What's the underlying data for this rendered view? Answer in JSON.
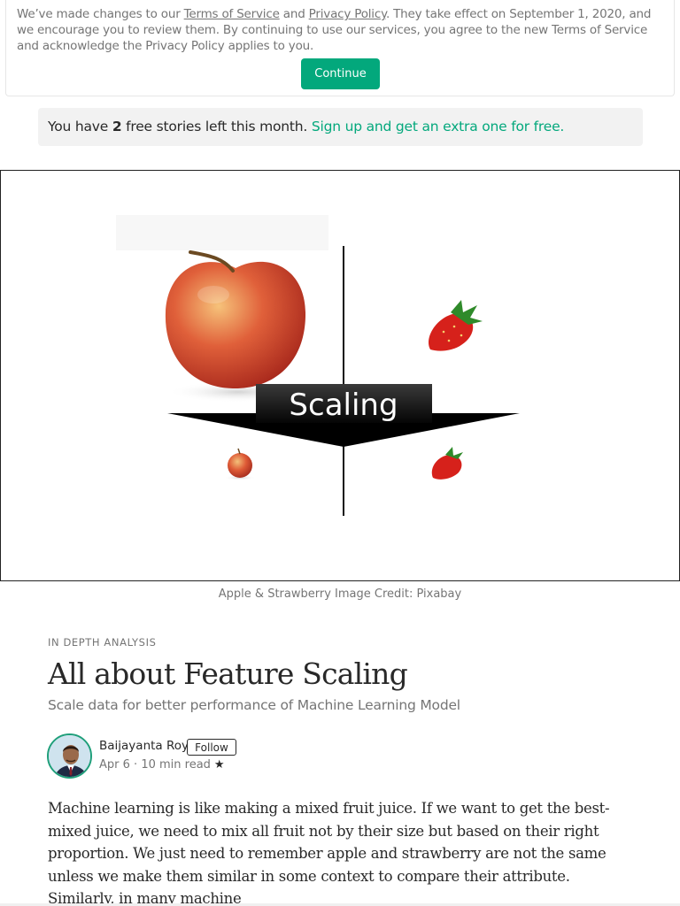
{
  "notice": {
    "prefix": "We’ve made changes to our ",
    "terms_link": "Terms of Service",
    "and": " and ",
    "privacy_link": "Privacy Policy",
    "suffix": ". They take effect on September 1, 2020, and we encourage you to review them. By continuing to use our services, you agree to the new Terms of Service and acknowledge the Privacy Policy applies to you.",
    "continue_label": "Continue"
  },
  "meter": {
    "prefix": "You have ",
    "count": "2",
    "middle": " free stories left this month. ",
    "signup_link": "Sign up and get an extra one for free."
  },
  "hero": {
    "label": "Scaling"
  },
  "caption": "Apple & Strawberry Image Credit: Pixabay",
  "article": {
    "kicker": "In Depth Analysis",
    "title": "All about Feature Scaling",
    "subtitle": "Scale data for better performance of Machine Learning Model",
    "author": "Baijayanta Roy",
    "follow_label": "Follow",
    "date": "Apr 6",
    "separator": " · ",
    "read_time": "10 min read",
    "star": "★",
    "body": "Machine learning is like making a mixed fruit juice. If we want to get the best-mixed juice, we need to mix all fruit not by their size but based on their right proportion. We just need to remember apple and strawberry are not the same unless we make them similar in some context to compare their attribute. Similarly, in many machine"
  },
  "colors": {
    "accent": "#03a87c",
    "meter_bg": "#f2f2f2",
    "muted_text": "#757575"
  }
}
